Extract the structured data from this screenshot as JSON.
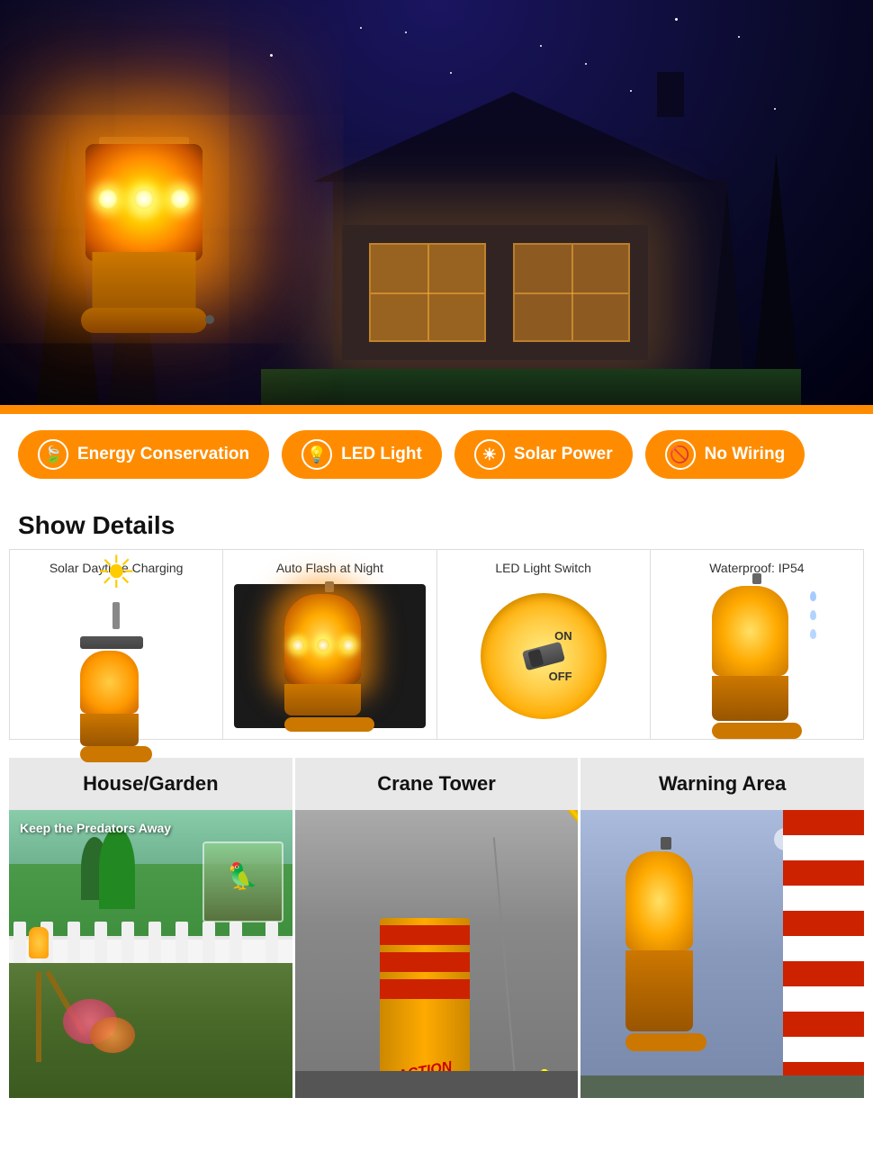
{
  "hero": {
    "alt": "Solar LED warning light at night with house background"
  },
  "features": [
    {
      "id": "energy-conservation",
      "label": "Energy Conservation",
      "icon": "🍃"
    },
    {
      "id": "led-light",
      "label": "LED Light",
      "icon": "💡"
    },
    {
      "id": "solar-power",
      "label": "Solar Power",
      "icon": "☀"
    },
    {
      "id": "no-wiring",
      "label": "No Wiring",
      "icon": "🚫"
    }
  ],
  "section_title": "Show Details",
  "detail_cells": [
    {
      "id": "solar-charging",
      "title": "Solar Daytime Charging"
    },
    {
      "id": "auto-flash",
      "title": "Auto Flash at Night"
    },
    {
      "id": "led-switch",
      "title": "LED Light Switch"
    },
    {
      "id": "waterproof",
      "title": "Waterproof: IP54"
    }
  ],
  "use_cases": [
    {
      "id": "house-garden",
      "title": "House/Garden",
      "sub": "Keep the Predators Away"
    },
    {
      "id": "crane-tower",
      "title": "Crane Tower",
      "sub": ""
    },
    {
      "id": "warning-area",
      "title": "Warning Area",
      "sub": ""
    }
  ]
}
